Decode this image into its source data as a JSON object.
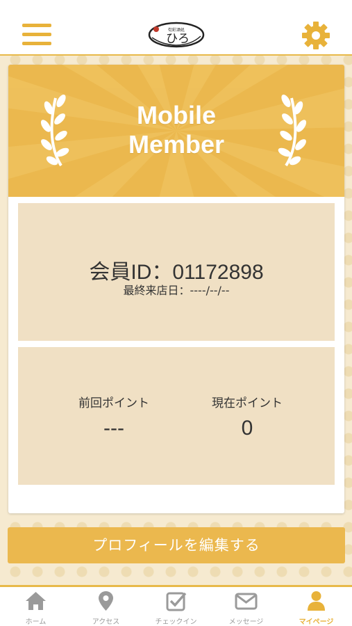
{
  "header": {
    "menu_icon": "hamburger-menu-icon",
    "logo_text": "ひろ",
    "logo_subtext": "旬彩酒処",
    "settings_icon": "gear-icon",
    "accent_color": "#e8b23a"
  },
  "banner": {
    "title_line1": "Mobile",
    "title_line2": "Member",
    "background_color": "#ebb84e"
  },
  "member": {
    "id_text": "会員ID：01172898",
    "last_visit": "最終来店日：----/--/--"
  },
  "points": {
    "previous_label": "前回ポイント",
    "previous_value": "---",
    "current_label": "現在ポイント",
    "current_value": "0"
  },
  "edit_profile_label": "プロフィールを編集する",
  "tabbar": {
    "items": [
      {
        "label": "ホーム",
        "icon": "home-icon",
        "active": false
      },
      {
        "label": "アクセス",
        "icon": "map-pin-icon",
        "active": false
      },
      {
        "label": "チェックイン",
        "icon": "checkin-icon",
        "active": false
      },
      {
        "label": "メッセージ",
        "icon": "envelope-icon",
        "active": false
      },
      {
        "label": "マイページ",
        "icon": "user-icon",
        "active": true
      }
    ],
    "active_color": "#e8b23a",
    "inactive_color": "#9a9a9a"
  }
}
